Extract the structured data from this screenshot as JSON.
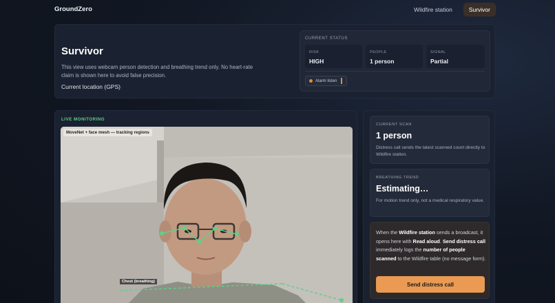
{
  "app": {
    "brand": "GroundZero"
  },
  "nav": {
    "items": [
      {
        "label": "Wildfire station"
      },
      {
        "label": "Survivor"
      }
    ]
  },
  "hero": {
    "title": "Survivor",
    "description": "This view uses webcam person detection and breathing trend only. No heart-rate claim is shown here to avoid false precision.",
    "location": "Current location (GPS)"
  },
  "status": {
    "heading": "CURRENT STATUS",
    "risk": {
      "label": "RISK",
      "value": "HIGH"
    },
    "people": {
      "label": "PEOPLE",
      "value": "1 person"
    },
    "signal": {
      "label": "SIGNAL",
      "value": "Partial"
    },
    "alarm_label": "Alarm listen",
    "alarm_color": "#e08a3c"
  },
  "monitor": {
    "label": "LIVE MONITORING",
    "badge": "MoveNet + face mesh — tracking regions",
    "chest_label": "Chest (breathing)",
    "accent_color": "#5fd08a"
  },
  "scan": {
    "label": "CURRENT SCAN",
    "value": "1 person",
    "description": "Distress call sends the latest scanned count directly to Wildfire station."
  },
  "breathing": {
    "label": "BREATHING TREND",
    "value": "Estimating…",
    "description": "For motion trend only, not a medical respiratory value."
  },
  "distress": {
    "t1": "When the ",
    "b1": "Wildfire station",
    "t2": " sends a broadcast, it opens here with ",
    "b2": "Read aloud",
    "t3": ". ",
    "b3": "Send distress call",
    "t4": " immediately logs the ",
    "b4": "number of people scanned",
    "t5": " to the Wildfire table (no message form).",
    "button": "Send distress call",
    "button_color": "#ea9a52"
  }
}
